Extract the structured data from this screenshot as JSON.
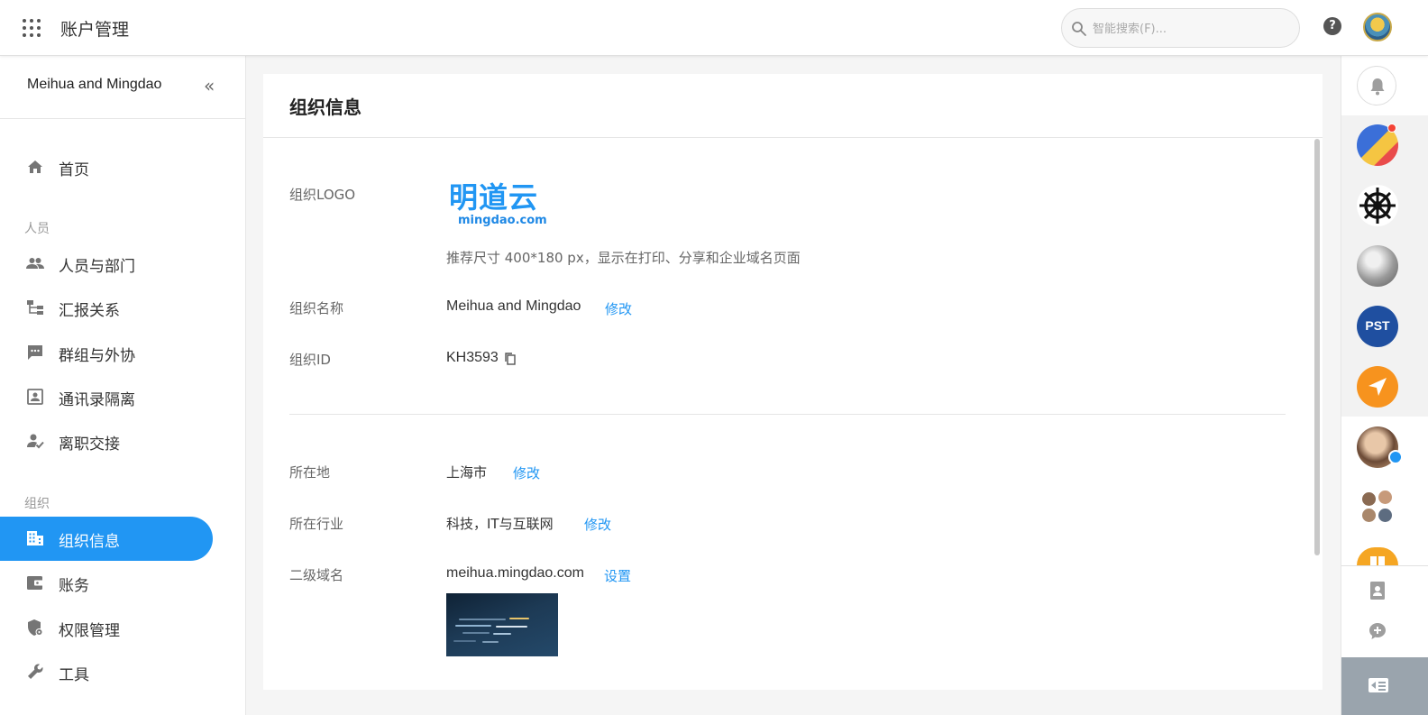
{
  "header": {
    "app_title": "账户管理",
    "search_placeholder": "智能搜索(F)...",
    "help_symbol": "?"
  },
  "sidebar": {
    "org_name": "Meihua and Mingdao",
    "collapse_symbol": "«",
    "home_label": "首页",
    "section_people": "人员",
    "people_items": [
      "人员与部门",
      "汇报关系",
      "群组与外协",
      "通讯录隔离",
      "离职交接"
    ],
    "section_org": "组织",
    "org_items": [
      "组织信息",
      "账务",
      "权限管理",
      "工具"
    ],
    "active_item": "组织信息"
  },
  "main": {
    "title": "组织信息",
    "logo_label": "组织LOGO",
    "logo_text": "明道云",
    "logo_subtext": "mingdao.com",
    "logo_hint": "推荐尺寸 400*180 px，显示在打印、分享和企业域名页面",
    "name_label": "组织名称",
    "name_value": "Meihua and Mingdao",
    "name_action": "修改",
    "id_label": "组织ID",
    "id_value": "KH3593",
    "location_label": "所在地",
    "location_value": "上海市",
    "location_action": "修改",
    "industry_label": "所在行业",
    "industry_value": "科技，IT与互联网",
    "industry_action": "修改",
    "domain_label": "二级域名",
    "domain_value": "meihua.mingdao.com",
    "domain_action": "设置"
  },
  "dock": {
    "pst_label": "PST"
  },
  "colors": {
    "accent": "#2196f3",
    "dock_bottom": "#9aa4ad",
    "notification": "#f44336"
  }
}
